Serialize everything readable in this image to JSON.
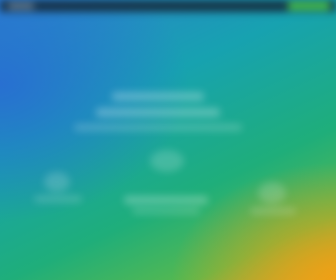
{
  "colors": {
    "background_top_left": "#2d7fd0",
    "background_mid": "#1fae7a",
    "background_bottom_right": "#d9a42a",
    "topbar": "#14283a",
    "cta_accent": "#47c24a"
  },
  "icons": {
    "logo": "logo-icon"
  }
}
